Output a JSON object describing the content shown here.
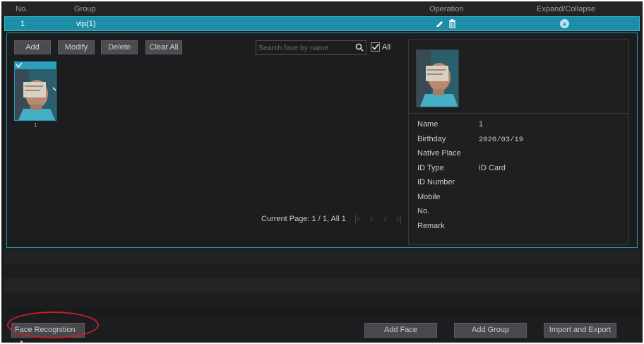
{
  "table_header": {
    "no": "No.",
    "group": "Group",
    "operation": "Operation",
    "expand": "Expand/Collapse"
  },
  "group_row": {
    "no": "1",
    "name": "vip(1)"
  },
  "toolbar": {
    "add": "Add",
    "modify": "Modify",
    "delete": "Delete",
    "clear_all": "Clear All"
  },
  "search": {
    "placeholder": "Search face by name",
    "all_label": "All",
    "all_checked": true
  },
  "faces": [
    {
      "caption": "1"
    }
  ],
  "pager": {
    "text": "Current Page: 1 / 1, All 1"
  },
  "detail": {
    "fields": [
      {
        "label": "Name",
        "value": "1"
      },
      {
        "label": "Birthday",
        "value": "2020/03/19"
      },
      {
        "label": "Native Place",
        "value": ""
      },
      {
        "label": "ID Type",
        "value": "ID Card"
      },
      {
        "label": "ID Number",
        "value": ""
      },
      {
        "label": "Mobile",
        "value": ""
      },
      {
        "label": "No.",
        "value": ""
      },
      {
        "label": "Remark",
        "value": ""
      }
    ]
  },
  "footer": {
    "face_recognition": "Face Recognition",
    "add_face": "Add Face",
    "add_group": "Add Group",
    "import_export": "Import and Export"
  },
  "colors": {
    "accent": "#1d8ea8",
    "highlight_ring": "#c81e28",
    "background": "#1a1b1d"
  },
  "icons": [
    "edit-icon",
    "trash-icon",
    "collapse-icon",
    "search-icon",
    "checkbox-icon",
    "first-page-icon",
    "prev-page-icon",
    "next-page-icon",
    "last-page-icon",
    "external-link-icon"
  ]
}
